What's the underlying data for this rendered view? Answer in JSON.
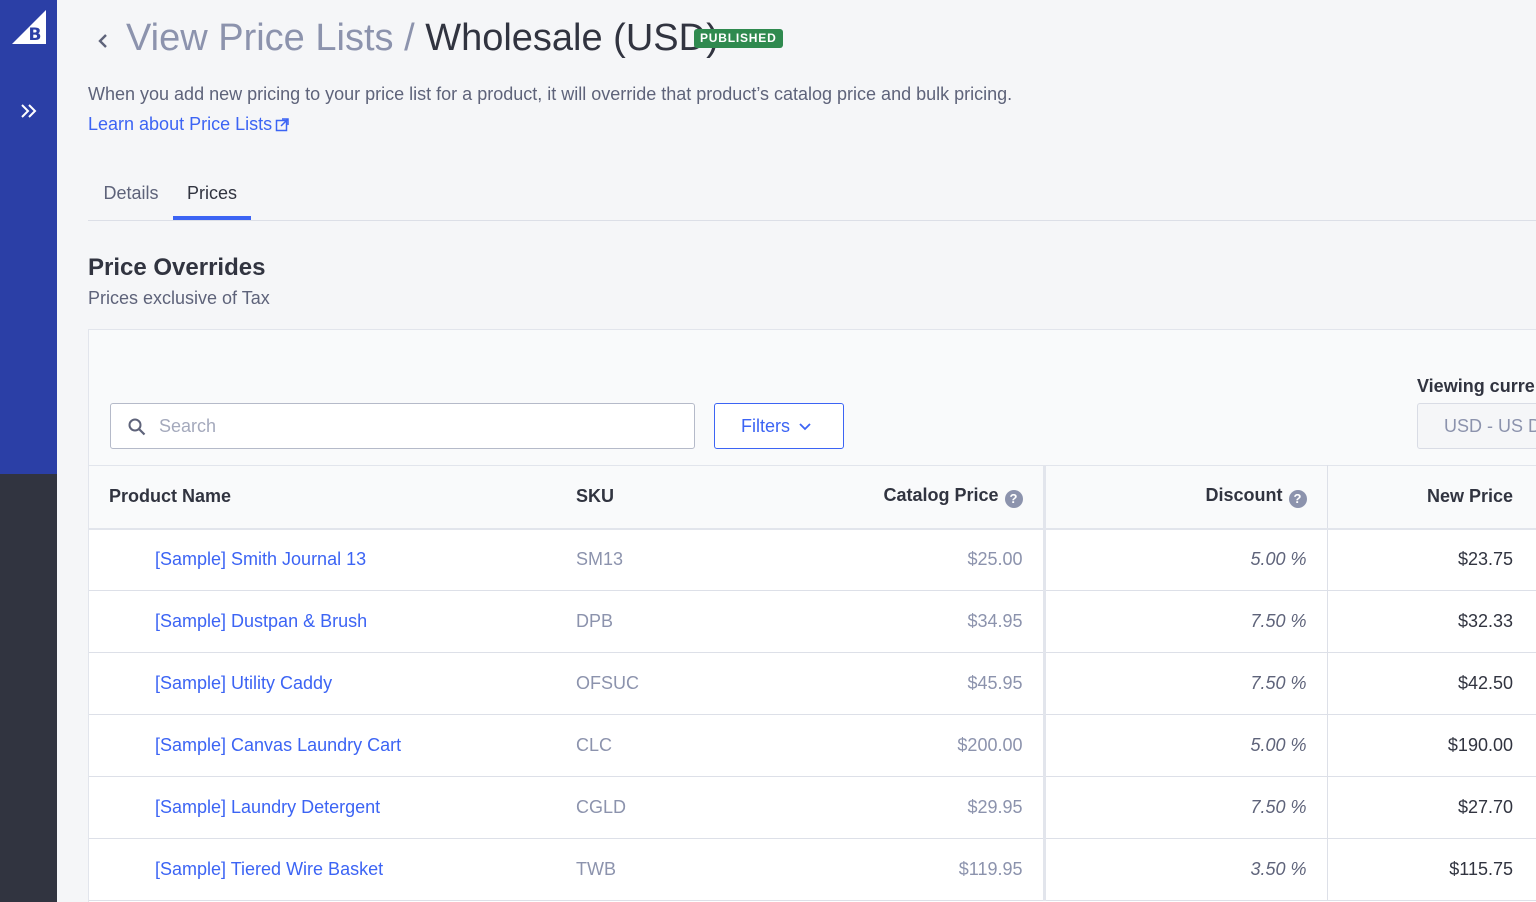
{
  "header": {
    "breadcrumb_parent": "View Price Lists",
    "breadcrumb_separator": "/",
    "title": "Wholesale (USD)",
    "status_badge": "PUBLISHED",
    "description": "When you add new pricing to your price list for a product, it will override that product’s catalog price and bulk pricing.",
    "learn_link": "Learn about Price Lists"
  },
  "tabs": [
    {
      "label": "Details",
      "active": false
    },
    {
      "label": "Prices",
      "active": true
    }
  ],
  "section": {
    "title": "Price Overrides",
    "subtitle": "Prices exclusive of Tax"
  },
  "toolbar": {
    "search_placeholder": "Search",
    "filters_label": "Filters",
    "currency_label": "Viewing currency",
    "currency_value": "USD - US Dollar"
  },
  "table": {
    "columns": {
      "product_name": "Product Name",
      "sku": "SKU",
      "catalog_price": "Catalog Price",
      "discount": "Discount",
      "new_price": "New Price"
    },
    "help_glyph": "?",
    "rows": [
      {
        "name": "[Sample] Smith Journal 13",
        "sku": "SM13",
        "catalog_price": "$25.00",
        "discount": "5.00 %",
        "new_price": "$23.75"
      },
      {
        "name": "[Sample] Dustpan & Brush",
        "sku": "DPB",
        "catalog_price": "$34.95",
        "discount": "7.50 %",
        "new_price": "$32.33"
      },
      {
        "name": "[Sample] Utility Caddy",
        "sku": "OFSUC",
        "catalog_price": "$45.95",
        "discount": "7.50 %",
        "new_price": "$42.50"
      },
      {
        "name": "[Sample] Canvas Laundry Cart",
        "sku": "CLC",
        "catalog_price": "$200.00",
        "discount": "5.00 %",
        "new_price": "$190.00"
      },
      {
        "name": "[Sample] Laundry Detergent",
        "sku": "CGLD",
        "catalog_price": "$29.95",
        "discount": "7.50 %",
        "new_price": "$27.70"
      },
      {
        "name": "[Sample] Tiered Wire Basket",
        "sku": "TWB",
        "catalog_price": "$119.95",
        "discount": "3.50 %",
        "new_price": "$115.75"
      }
    ]
  },
  "icons": {
    "logo": "bigcommerce-logo-icon",
    "expand": "double-chevron-right-icon",
    "back": "chevron-left-icon",
    "external": "external-link-icon",
    "search": "search-icon",
    "filters": "chevron-down-icon",
    "help": "help-circle-icon"
  },
  "colors": {
    "rail_top": "#2b3fa6",
    "rail_bottom": "#313440",
    "accent": "#3c64f4",
    "badge": "#2f8a4f",
    "page_bg": "#f5f6f8"
  }
}
